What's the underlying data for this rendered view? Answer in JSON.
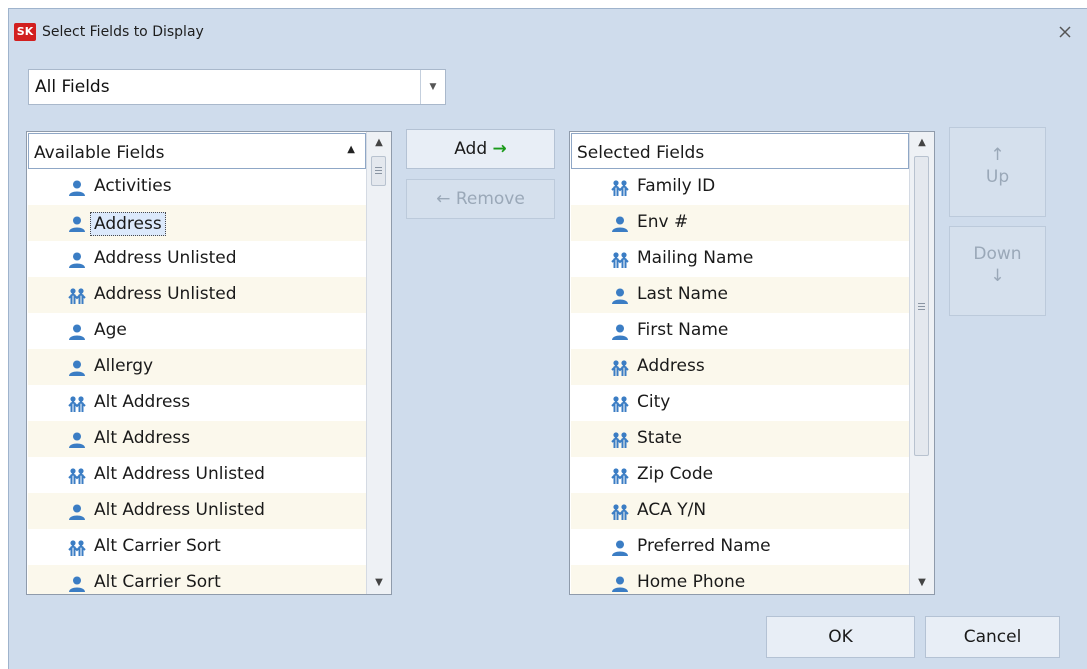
{
  "window": {
    "app_icon_text": "SK",
    "title": "Select Fields to Display",
    "close_icon": "close-icon"
  },
  "filter": {
    "selected": "All Fields",
    "dropdown_icon": "chevron-down-icon"
  },
  "available": {
    "header": "Available Fields",
    "sort_icon": "sort-ascending-icon",
    "items": [
      {
        "label": "Activities",
        "icon": "person-icon"
      },
      {
        "label": "Address",
        "icon": "person-icon",
        "selected": true
      },
      {
        "label": "Address Unlisted",
        "icon": "person-icon"
      },
      {
        "label": "Address Unlisted",
        "icon": "family-icon"
      },
      {
        "label": "Age",
        "icon": "person-icon"
      },
      {
        "label": "Allergy",
        "icon": "person-icon"
      },
      {
        "label": "Alt Address",
        "icon": "family-icon"
      },
      {
        "label": "Alt Address",
        "icon": "person-icon"
      },
      {
        "label": "Alt Address Unlisted",
        "icon": "family-icon"
      },
      {
        "label": "Alt Address Unlisted",
        "icon": "person-icon"
      },
      {
        "label": "Alt Carrier Sort",
        "icon": "family-icon"
      },
      {
        "label": "Alt Carrier Sort",
        "icon": "person-icon"
      }
    ]
  },
  "selected": {
    "header": "Selected Fields",
    "items": [
      {
        "label": "Family ID",
        "icon": "family-icon"
      },
      {
        "label": "Env #",
        "icon": "person-icon"
      },
      {
        "label": "Mailing Name",
        "icon": "family-icon"
      },
      {
        "label": "Last Name",
        "icon": "person-icon"
      },
      {
        "label": "First Name",
        "icon": "person-icon"
      },
      {
        "label": "Address",
        "icon": "family-icon"
      },
      {
        "label": "City",
        "icon": "family-icon"
      },
      {
        "label": "State",
        "icon": "family-icon"
      },
      {
        "label": "Zip Code",
        "icon": "family-icon"
      },
      {
        "label": "ACA Y/N",
        "icon": "family-icon"
      },
      {
        "label": "Preferred Name",
        "icon": "person-icon"
      },
      {
        "label": "Home Phone",
        "icon": "person-icon"
      }
    ]
  },
  "buttons": {
    "add": "Add",
    "add_arrow": "→",
    "remove_arrow": "←",
    "remove": "Remove",
    "up_arrow": "↑",
    "up": "Up",
    "down": "Down",
    "down_arrow": "↓",
    "ok": "OK",
    "cancel": "Cancel"
  },
  "colors": {
    "dialog_bg": "#cfdcec",
    "icon_blue": "#3b7dc4",
    "selected_row": "#dce9fb",
    "alt_row": "#fbf8ec",
    "add_arrow_green": "#1a9a1a"
  }
}
